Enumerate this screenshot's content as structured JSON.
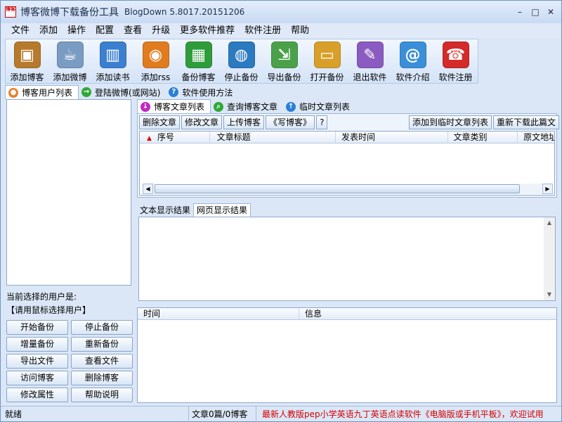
{
  "window": {
    "title": "博客微博下载备份工具",
    "version": "BlogDown 5.8017.20151206",
    "app_icon_text": "博客"
  },
  "menu": [
    "文件",
    "添加",
    "操作",
    "配置",
    "查看",
    "升级",
    "更多软件推荐",
    "软件注册",
    "帮助"
  ],
  "toolbar": [
    {
      "label": "添加博客",
      "icon": "box-icon",
      "color": "#b57a2c",
      "glyph": "▣"
    },
    {
      "label": "添加微博",
      "icon": "cup-icon",
      "color": "#7a9cc2",
      "glyph": "☕"
    },
    {
      "label": "添加读书",
      "icon": "books-icon",
      "color": "#3b7fd0",
      "glyph": "▥"
    },
    {
      "label": "添加rss",
      "icon": "rss-icon",
      "color": "#e07b20",
      "glyph": "◉"
    },
    {
      "label": "备份博客",
      "icon": "cube-icon",
      "color": "#2f9c3c",
      "glyph": "▦"
    },
    {
      "label": "停止备份",
      "icon": "globe-icon",
      "color": "#2c7ac0",
      "glyph": "◍"
    },
    {
      "label": "导出备份",
      "icon": "export-icon",
      "color": "#4aa14a",
      "glyph": "⇲"
    },
    {
      "label": "打开备份",
      "icon": "tv-icon",
      "color": "#d8a02a",
      "glyph": "▭"
    },
    {
      "label": "退出软件",
      "icon": "pencils-icon",
      "color": "#8a5bc0",
      "glyph": "✎"
    },
    {
      "label": "软件介绍",
      "icon": "notebook-icon",
      "color": "#3a8fd8",
      "glyph": "@"
    },
    {
      "label": "软件注册",
      "icon": "phone-icon",
      "color": "#d42a2a",
      "glyph": "☎"
    }
  ],
  "left_tabs": [
    {
      "label": "博客用户列表",
      "icon": "user-icon",
      "color": "#e8802a",
      "glyph": "●"
    },
    {
      "label": "登陆微博(或网站)",
      "icon": "login-icon",
      "color": "#2fa836",
      "glyph": "→"
    },
    {
      "label": "软件使用方法",
      "icon": "help-icon",
      "color": "#2a7fd4",
      "glyph": "?"
    }
  ],
  "current_user": {
    "label": "当前选择的用户是:",
    "value": "【请用鼠标选择用户】"
  },
  "left_buttons": [
    "开始备份",
    "停止备份",
    "增量备份",
    "重新备份",
    "导出文件",
    "查看文件",
    "访问博客",
    "删除博客",
    "修改属性",
    "帮助说明"
  ],
  "right_tabs": [
    {
      "label": "博客文章列表",
      "icon": "down-arrow-icon",
      "color": "#c02ac0",
      "glyph": "↓"
    },
    {
      "label": "查询博客文章",
      "icon": "search-icon",
      "color": "#2fa836",
      "glyph": "⌕"
    },
    {
      "label": "临时文章列表",
      "icon": "up-arrow-icon",
      "color": "#2a7fd4",
      "glyph": "↑"
    }
  ],
  "article_actions": [
    "删除文章",
    "修改文章",
    "上传博客",
    "《写博客》",
    "?"
  ],
  "article_actions_right": [
    "添加到临时文章列表",
    "重新下载此篇文"
  ],
  "article_columns": [
    "序号",
    "文章标题",
    "发表时间",
    "文章类别",
    "原文地址"
  ],
  "result_tabs": [
    "文本显示结果",
    "网页显示结果"
  ],
  "log_columns": [
    "时间",
    "信息"
  ],
  "status": {
    "ready": "就绪",
    "count": "文章0篇/0博客",
    "ad": "最新人教版pep小学英语九丁英语点读软件《电脑版或手机平板》，欢迎试用"
  }
}
